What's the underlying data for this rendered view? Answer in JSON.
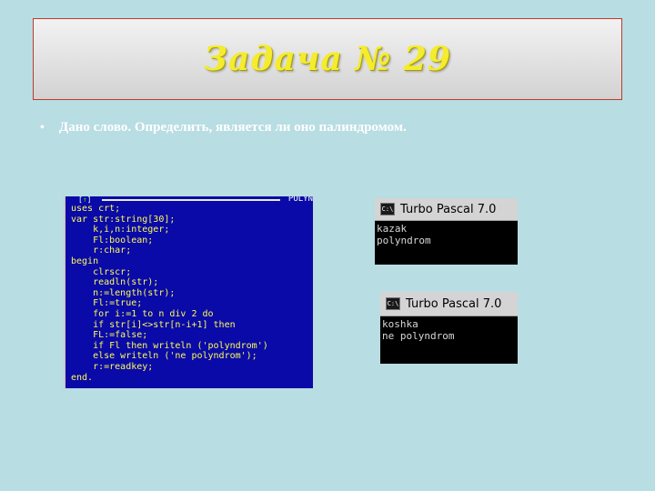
{
  "slide": {
    "title": "Задача № 29",
    "bullet": "•",
    "task_text": "Дано слово. Определить, является ли оно палиндромом."
  },
  "editor": {
    "marker_left": "[",
    "marker_mid": "↑",
    "marker_right": "]",
    "filename": "POLYN",
    "code_lines": [
      "uses crt;",
      "var str:string[30];",
      "    k,i,n:integer;",
      "    Fl:boolean;",
      "    r:char;",
      "begin",
      "    clrscr;",
      "    readln(str);",
      "    n:=length(str);",
      "    Fl:=true;",
      "    for i:=1 to n div 2 do",
      "    if str[i]<>str[n-i+1] then",
      "    FL:=false;",
      "    if Fl then writeln ('polyndrom')",
      "    else writeln ('ne polyndrom');",
      "    r:=readkey;",
      "end."
    ]
  },
  "outputs": [
    {
      "icon": "C:\\",
      "title": "Turbo Pascal 7.0",
      "lines": [
        "kazak",
        "polyndrom"
      ]
    },
    {
      "icon": "C:\\",
      "title": "Turbo Pascal 7.0",
      "lines": [
        "koshka",
        "ne polyndrom"
      ]
    }
  ],
  "colors": {
    "background": "#b8dde3",
    "title_text": "#f4ec2c",
    "title_border": "#c0392b",
    "editor_bg": "#0a0aa8",
    "code_text": "#fcfc54"
  }
}
